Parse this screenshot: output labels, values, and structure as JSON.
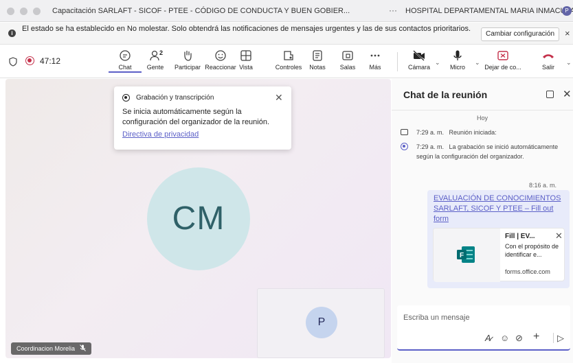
{
  "window": {
    "title": "Capacitación SARLAFT - SICOF - PTEE - CÓDIGO DE CONDUCTA Y BUEN GOBIER...",
    "more": "···",
    "org": "HOSPITAL DEPARTAMENTAL MARIA INMACULADA",
    "org_initial": "P"
  },
  "notification": {
    "text": "El estado se ha establecido en No molestar. Solo obtendrá las notificaciones de mensajes urgentes y las de sus contactos prioritarios.",
    "button": "Cambiar configuración",
    "close": "×"
  },
  "toolbar": {
    "timer": "47:12",
    "buttons": [
      {
        "label": "Chat",
        "icon": "chat-icon",
        "active": true
      },
      {
        "label": "Gente",
        "icon": "people-icon",
        "badge": "2"
      },
      {
        "label": "Participar",
        "icon": "raise-hand-icon"
      },
      {
        "label": "Reaccionar",
        "icon": "smiley-icon"
      },
      {
        "label": "Vista",
        "icon": "grid-view-icon"
      },
      {
        "label": "Controles",
        "icon": "apps-icon"
      },
      {
        "label": "Notas",
        "icon": "notes-icon"
      },
      {
        "label": "Salas",
        "icon": "rooms-icon"
      },
      {
        "label": "Más",
        "icon": "more-icon"
      },
      {
        "label": "Cámara",
        "icon": "camera-off-icon"
      },
      {
        "label": "Micro",
        "icon": "microphone-icon"
      },
      {
        "label": "Dejar de co...",
        "icon": "stop-share-icon"
      },
      {
        "label": "Salir",
        "icon": "hang-up-icon"
      }
    ],
    "colors": {
      "accent": "#5b5fc7",
      "danger": "#c4314b"
    }
  },
  "stage": {
    "recording_popup": {
      "title": "Grabación y transcripción",
      "body": "Se inicia automáticamente según la configuración del organizador de la reunión.",
      "link": "Directiva de privacidad"
    },
    "main_avatar": "CM",
    "pip_avatar": "P",
    "name_tag": "Coordinacion Morelia"
  },
  "chat": {
    "title": "Chat de la reunión",
    "day": "Hoy",
    "events": [
      {
        "time": "7:29 a. m.",
        "text": "Reunión iniciada:",
        "icon": "meeting-icon"
      },
      {
        "time": "7:29 a. m.",
        "text": "La grabación se inició automáticamente según la configuración del organizador.",
        "icon": "recording-icon"
      }
    ],
    "message": {
      "time": "8:16 a. m.",
      "link": "EVALUACIÓN DE CONOCIMIENTOS SARLAFT, SICOF Y PTEE – Fill out form",
      "card": {
        "title": "Fill | EV...",
        "desc": "Con el propósito de identificar e...",
        "domain": "forms.office.com"
      }
    },
    "compose_placeholder": "Escriba un mensaje"
  }
}
